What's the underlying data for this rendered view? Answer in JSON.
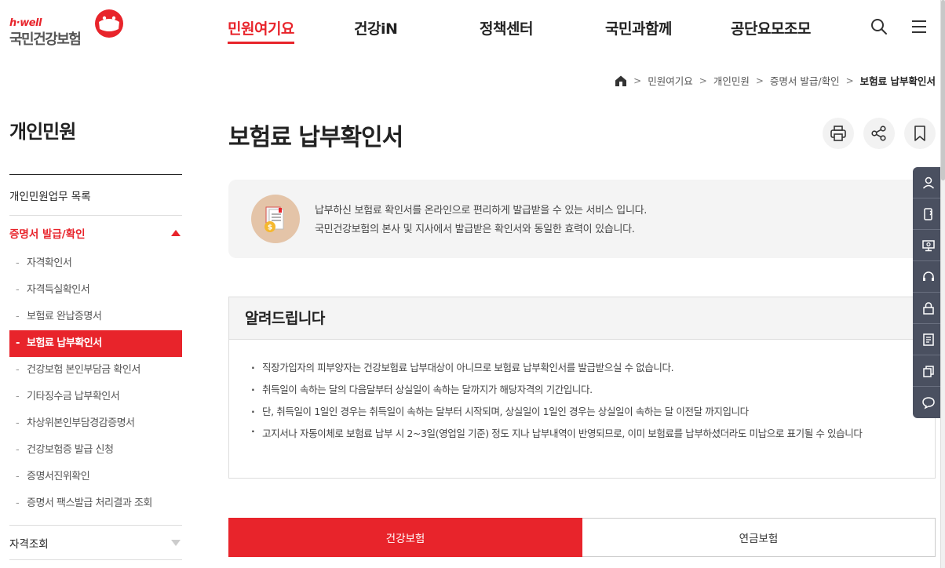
{
  "logo": {
    "tagline": "h·well",
    "name": "국민건강보험"
  },
  "gnb": [
    {
      "label": "민원여기요"
    },
    {
      "label": "건강iN"
    },
    {
      "label": "정책센터"
    },
    {
      "label": "국민과함께"
    },
    {
      "label": "공단요모조모"
    }
  ],
  "header_icons": [
    "search-icon",
    "menu-icon"
  ],
  "breadcrumb": {
    "home_icon": "home-icon",
    "items": [
      "민원여기요",
      "개인민원",
      "증명서 발급/확인"
    ],
    "current": "보험료 납부확인서"
  },
  "lnb": {
    "title": "개인민원",
    "top_item": "개인민원업무 목록",
    "open_category": "증명서 발급/확인",
    "sub_items": [
      "자격확인서",
      "자격득실확인서",
      "보험료 완납증명서",
      "보험료 납부확인서",
      "건강보험 본인부담금 확인서",
      "기타징수금 납부확인서",
      "차상위본인부담경감증명서",
      "건강보험증 발급 신청",
      "증명서진위확인",
      "증명서 팩스발급 처리결과 조회"
    ],
    "active_sub": "보험료 납부확인서",
    "next_category": "자격조회"
  },
  "page": {
    "title": "보험료 납부확인서",
    "tools": [
      "print-icon",
      "share-icon",
      "bookmark-icon"
    ]
  },
  "intro": {
    "line1": "납부하신 보험료 확인서를 온라인으로 편리하게 발급받을 수 있는 서비스 입니다.",
    "line2": "국민건강보험의 본사 및 지사에서 발급받은 확인서와 동일한 효력이 있습니다."
  },
  "notice": {
    "title": "알려드립니다",
    "items": [
      "직장가입자의 피부양자는 건강보험료 납부대상이 아니므로 보험료 납부확인서를 발급받으실 수 없습니다.",
      "취득일이 속하는 달의 다음달부터 상실일이 속하는 달까지가 해당자격의 기간입니다.",
      "단, 취득일이 1일인 경우는 취득일이 속하는 달부터 시작되며, 상실일이 1일인 경우는 상실일이 속하는 달 이전달 까지입니다",
      "고지서나 자동이체로 보험료 납부 시 2~3일(영업일 기준) 정도 지나 납부내역이 반영되므로, 이미 보험료를 납부하셨더라도 미납으로 표기될 수 있습니다"
    ]
  },
  "tabs": [
    {
      "label": "건강보험"
    },
    {
      "label": "연금보험"
    }
  ],
  "quick_menu": [
    "user-icon",
    "phone-icon",
    "monitor-icon",
    "headset-icon",
    "lock-icon",
    "document-icon",
    "copy-icon",
    "chat-icon"
  ],
  "colors": {
    "accent": "#e8242b",
    "quick_bg": "#4a5060"
  }
}
